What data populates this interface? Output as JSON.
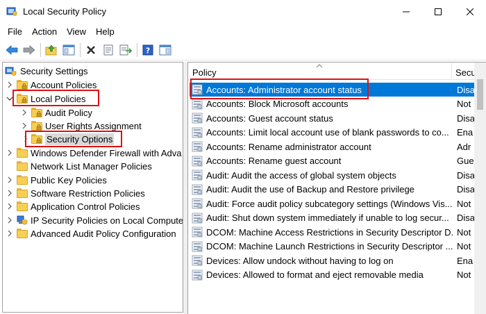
{
  "window": {
    "title": "Local Security Policy",
    "minimize_glyph": "—",
    "maximize_glyph": "☐",
    "close_glyph": "✕"
  },
  "menu": [
    "File",
    "Action",
    "View",
    "Help"
  ],
  "toolbar": {
    "icons": [
      "back-arrow-icon",
      "forward-arrow-icon",
      "up-folder-icon",
      "show-hide-tree-icon",
      "delete-icon",
      "properties-icon",
      "export-list-icon",
      "help-icon",
      "console-icon"
    ]
  },
  "tree": {
    "root": "Security Settings",
    "items": [
      {
        "label": "Account Policies",
        "level": 1,
        "expander": ">",
        "locked": true
      },
      {
        "label": "Local Policies",
        "level": 1,
        "expander": "v",
        "locked": true
      },
      {
        "label": "Audit Policy",
        "level": 2,
        "expander": ">",
        "locked": true
      },
      {
        "label": "User Rights Assignment",
        "level": 2,
        "expander": ">",
        "locked": true
      },
      {
        "label": "Security Options",
        "level": 2,
        "expander": "",
        "locked": true,
        "selected": true
      },
      {
        "label": "Windows Defender Firewall with Adva",
        "level": 1,
        "expander": ">",
        "locked": false
      },
      {
        "label": "Network List Manager Policies",
        "level": 1,
        "expander": "",
        "locked": false
      },
      {
        "label": "Public Key Policies",
        "level": 1,
        "expander": ">",
        "locked": false
      },
      {
        "label": "Software Restriction Policies",
        "level": 1,
        "expander": ">",
        "locked": false
      },
      {
        "label": "Application Control Policies",
        "level": 1,
        "expander": ">",
        "locked": false
      },
      {
        "label": "IP Security Policies on Local Compute",
        "level": 1,
        "expander": ">",
        "locked": false,
        "ipsec": true
      },
      {
        "label": "Advanced Audit Policy Configuration",
        "level": 1,
        "expander": ">",
        "locked": false
      }
    ]
  },
  "list": {
    "columns": [
      "Policy",
      "Secu"
    ],
    "rows": [
      {
        "policy": "Accounts: Administrator account status",
        "setting": "Disa",
        "selected": true
      },
      {
        "policy": "Accounts: Block Microsoft accounts",
        "setting": "Not"
      },
      {
        "policy": "Accounts: Guest account status",
        "setting": "Disa"
      },
      {
        "policy": "Accounts: Limit local account use of blank passwords to co...",
        "setting": "Ena"
      },
      {
        "policy": "Accounts: Rename administrator account",
        "setting": "Adr"
      },
      {
        "policy": "Accounts: Rename guest account",
        "setting": "Gue"
      },
      {
        "policy": "Audit: Audit the access of global system objects",
        "setting": "Disa"
      },
      {
        "policy": "Audit: Audit the use of Backup and Restore privilege",
        "setting": "Disa"
      },
      {
        "policy": "Audit: Force audit policy subcategory settings (Windows Vis...",
        "setting": "Not"
      },
      {
        "policy": "Audit: Shut down system immediately if unable to log secur...",
        "setting": "Disa"
      },
      {
        "policy": "DCOM: Machine Access Restrictions in Security Descriptor D...",
        "setting": "Not"
      },
      {
        "policy": "DCOM: Machine Launch Restrictions in Security Descriptor ...",
        "setting": "Not"
      },
      {
        "policy": "Devices: Allow undock without having to log on",
        "setting": "Ena"
      },
      {
        "policy": "Devices: Allowed to format and eject removable media",
        "setting": "Not"
      }
    ]
  },
  "colors": {
    "selection": "#0078d7",
    "highlight_box": "#e01010"
  }
}
